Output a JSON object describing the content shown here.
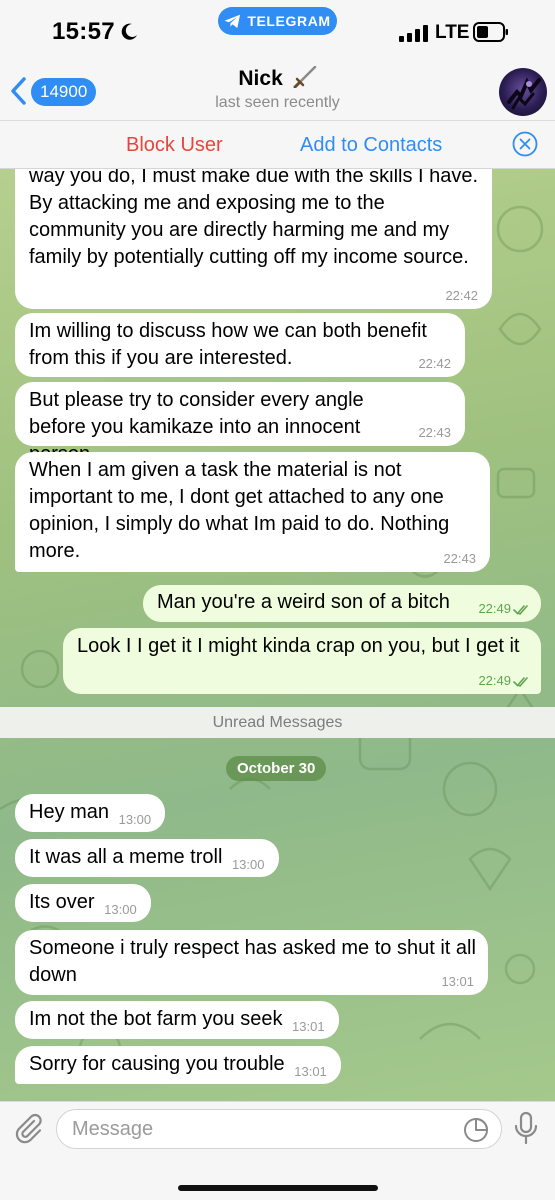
{
  "status_bar": {
    "time": "15:57",
    "app_pill": "TELEGRAM",
    "network": "LTE"
  },
  "header": {
    "back_count": "14900",
    "name": "Nick",
    "status": "last seen recently"
  },
  "actions": {
    "block_label": "Block User",
    "add_label": "Add to Contacts"
  },
  "messages_before": [
    {
      "text": "way you do, I must make due with the skills I have. By attacking me and exposing me to the community you are directly harming me and my family by potentially cutting off my income source.",
      "time": "22:42"
    },
    {
      "text": "Im willing to discuss how we can both benefit from this if you are interested.",
      "time": "22:42"
    },
    {
      "text": "But please try to consider every angle before you kamikaze into an innocent person.",
      "time": "22:43"
    },
    {
      "text": "When I am given a task the material is not important to me, I dont get attached to any one opinion, I simply do what Im paid to do. Nothing more.",
      "time": "22:43"
    }
  ],
  "outgoing": [
    {
      "text": "Man you're a weird son of a bitch",
      "time": "22:49"
    },
    {
      "text": "Look I I get it I might kinda crap on you, but I get it",
      "time": "22:49"
    }
  ],
  "unread_label": "Unread Messages",
  "date_label": "October 30",
  "messages_after": [
    {
      "text": "Hey man",
      "time": "13:00"
    },
    {
      "text": "It was all a meme troll",
      "time": "13:00"
    },
    {
      "text": "Its over",
      "time": "13:00"
    },
    {
      "text": "Someone i truly respect has asked me to shut it all down",
      "time": "13:01"
    },
    {
      "text": "Im not the bot farm you seek",
      "time": "13:01"
    },
    {
      "text": "Sorry for causing you trouble",
      "time": "13:01"
    }
  ],
  "input": {
    "placeholder": "Message",
    "value": ""
  },
  "colors": {
    "accent": "#2f8df3",
    "danger": "#e6453c",
    "incoming_bubble": "#ffffff",
    "outgoing_bubble": "#effdde",
    "read_check": "#5fa54d"
  },
  "icons": [
    "moon-icon",
    "telegram-icon",
    "signal-icon",
    "battery-icon",
    "back-chevron-icon",
    "sword-icon",
    "close-circle-icon",
    "attach-icon",
    "sticker-icon",
    "mic-icon",
    "double-check-icon"
  ]
}
